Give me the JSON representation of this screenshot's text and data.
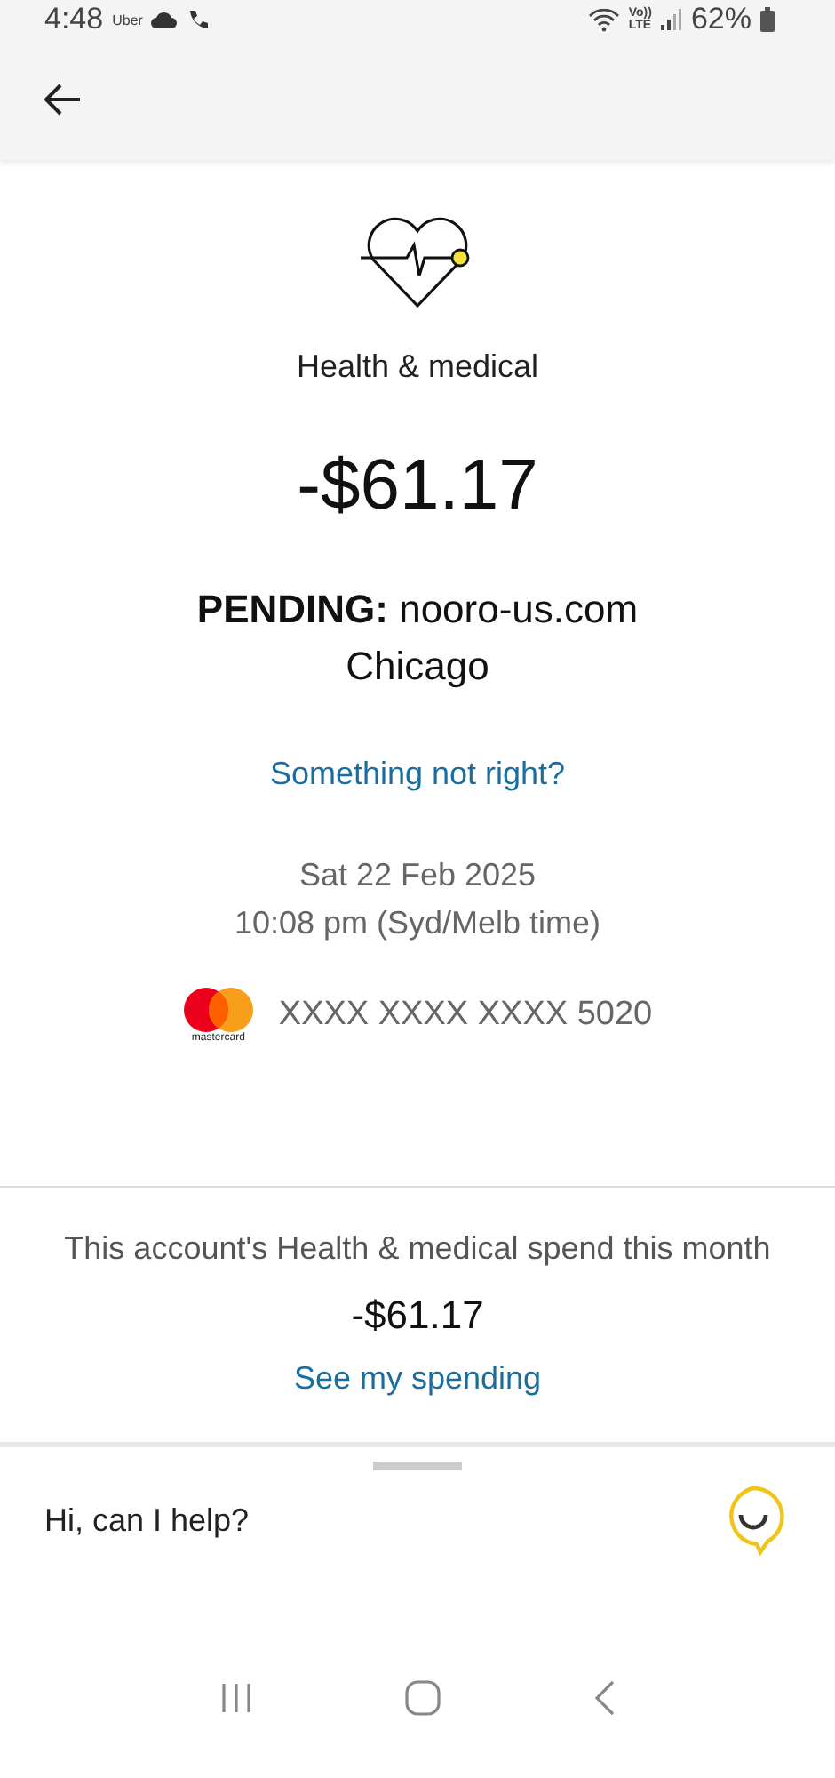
{
  "status_bar": {
    "time": "4:48",
    "app_label": "Uber",
    "network": [
      "Vo))",
      "LTE"
    ],
    "battery": "62%"
  },
  "transaction": {
    "category": "Health & medical",
    "amount": "-$61.17",
    "status": "PENDING:",
    "merchant": "nooro-us.com",
    "location": "Chicago",
    "help_link": "Something not right?",
    "date": "Sat 22 Feb 2025",
    "time": "10:08 pm (Syd/Melb time)",
    "card_brand": "mastercard",
    "card_number": "XXXX XXXX XXXX 5020"
  },
  "spend_summary": {
    "text": "This account's Health & medical spend this month",
    "amount": "-$61.17",
    "link": "See my spending"
  },
  "assistant": {
    "prompt": "Hi, can I help?"
  }
}
